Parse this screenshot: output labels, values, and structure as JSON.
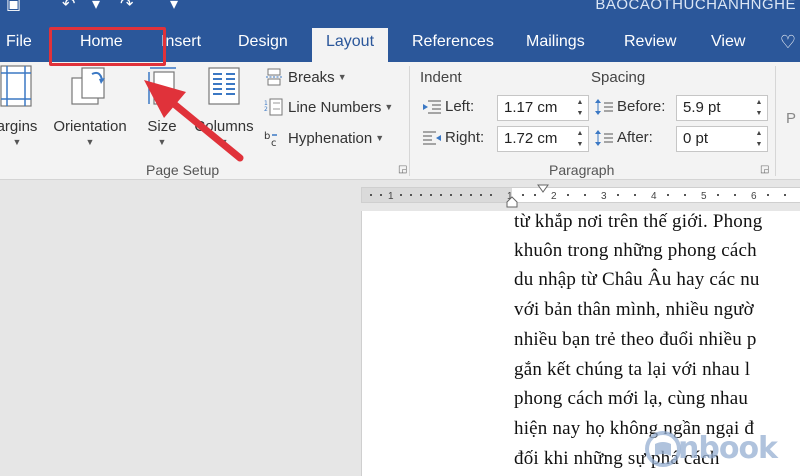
{
  "window": {
    "title": "BAOCAOTHUCHANHNGHE"
  },
  "tabs": [
    {
      "label": "File"
    },
    {
      "label": "Home"
    },
    {
      "label": "Insert"
    },
    {
      "label": "Design"
    },
    {
      "label": "Layout"
    },
    {
      "label": "References"
    },
    {
      "label": "Mailings"
    },
    {
      "label": "Review"
    },
    {
      "label": "View"
    }
  ],
  "active_tab": "Layout",
  "highlight": {
    "target": "Home",
    "color": "#e0323a"
  },
  "ribbon": {
    "page_setup": {
      "margins_label": "argins",
      "orientation_label": "Orientation",
      "size_label": "Size",
      "columns_label": "Columns",
      "breaks_label": "Breaks",
      "line_numbers_label": "Line Numbers",
      "hyphenation_label": "Hyphenation",
      "group_label": "Page Setup"
    },
    "paragraph": {
      "indent_title": "Indent",
      "spacing_title": "Spacing",
      "left_label": "Left:",
      "left_value": "1.17 cm",
      "right_label": "Right:",
      "right_value": "1.72 cm",
      "before_label": "Before:",
      "before_value": "5.9 pt",
      "after_label": "After:",
      "after_value": "0 pt",
      "group_label": "Paragraph"
    },
    "next_group_partial": "P"
  },
  "ruler": {
    "ticks": [
      "1",
      "1",
      "2",
      "3",
      "4",
      "5",
      "6"
    ]
  },
  "document": {
    "lines": [
      "từ khắp nơi trên thế giới. Phong",
      "khuôn trong những phong cách",
      "du nhập từ Châu Âu hay các nu",
      "với bản thân mình, nhiều ngườ",
      "nhiều bạn trẻ theo đuổi nhiều p",
      "gắn kết chúng ta lại với nhau l",
      "phong cách mới lạ, cùng nhau",
      "hiện nay họ không ngần ngại đ",
      "đối khi những sự phá cách"
    ]
  },
  "watermark": {
    "text": "nbook"
  },
  "colors": {
    "titlebar": "#2b579a",
    "ribbon": "#f3f3f3",
    "workspace": "#e6e6e6",
    "accent_red": "#e0323a"
  }
}
